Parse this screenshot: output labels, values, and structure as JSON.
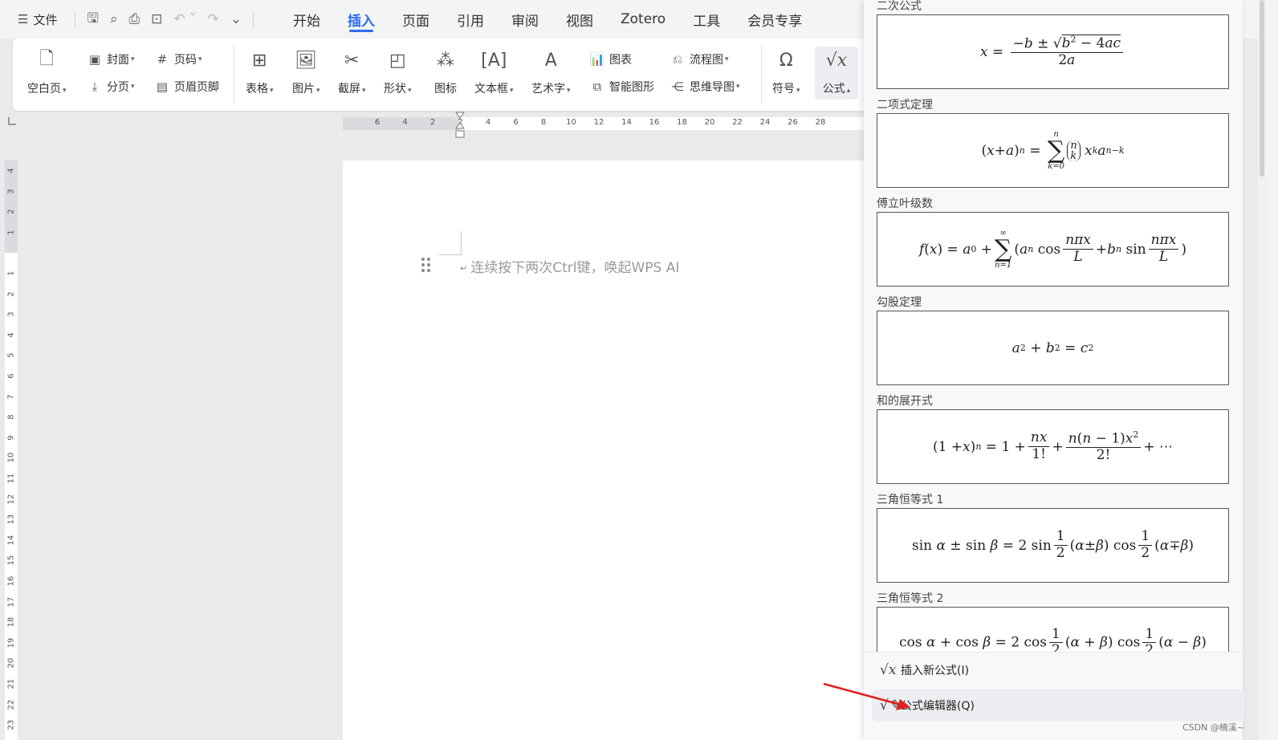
{
  "menubar": {
    "file_label": "文件",
    "tabs": [
      "开始",
      "插入",
      "页面",
      "引用",
      "审阅",
      "视图",
      "Zotero",
      "工具",
      "会员专享"
    ],
    "active_tab": "插入"
  },
  "ribbon": {
    "blank_page": "空白页",
    "cover": "封面",
    "page_break": "分页",
    "page_number": "页码",
    "header_footer": "页眉页脚",
    "table": "表格",
    "picture": "图片",
    "screenshot": "截屏",
    "shape": "形状",
    "icon": "图标",
    "textbox": "文本框",
    "wordart": "艺术字",
    "chart": "图表",
    "smartart": "智能图形",
    "flowchart": "流程图",
    "mindmap": "思维导图",
    "symbol": "符号",
    "formula": "公式"
  },
  "ruler": {
    "h_ticks": [
      "6",
      "4",
      "2",
      "2",
      "4",
      "6",
      "8",
      "10",
      "12",
      "14",
      "16",
      "18",
      "20",
      "22",
      "24",
      "26",
      "28"
    ],
    "v_ticks_top": [
      "4",
      "3",
      "2",
      "1"
    ],
    "v_ticks": [
      "1",
      "2",
      "3",
      "4",
      "5",
      "6",
      "7",
      "8",
      "9",
      "10",
      "11",
      "12",
      "13",
      "14",
      "15",
      "16",
      "17",
      "18",
      "19",
      "20",
      "21",
      "22",
      "23"
    ]
  },
  "document": {
    "placeholder": "连续按下两次Ctrl键，唤起WPS AI"
  },
  "formula_panel": {
    "items": [
      {
        "label": "二次公式"
      },
      {
        "label": "二项式定理"
      },
      {
        "label": "傅立叶级数"
      },
      {
        "label": "勾股定理"
      },
      {
        "label": "和的展开式"
      },
      {
        "label": "三角恒等式 1"
      },
      {
        "label": "三角恒等式 2"
      }
    ],
    "insert_new": "插入新公式(I)",
    "editor": "公式编辑器(Q)"
  },
  "watermark": "CSDN @楠溪~",
  "colors": {
    "accent": "#2d6bf0",
    "arrow": "#e02020"
  }
}
